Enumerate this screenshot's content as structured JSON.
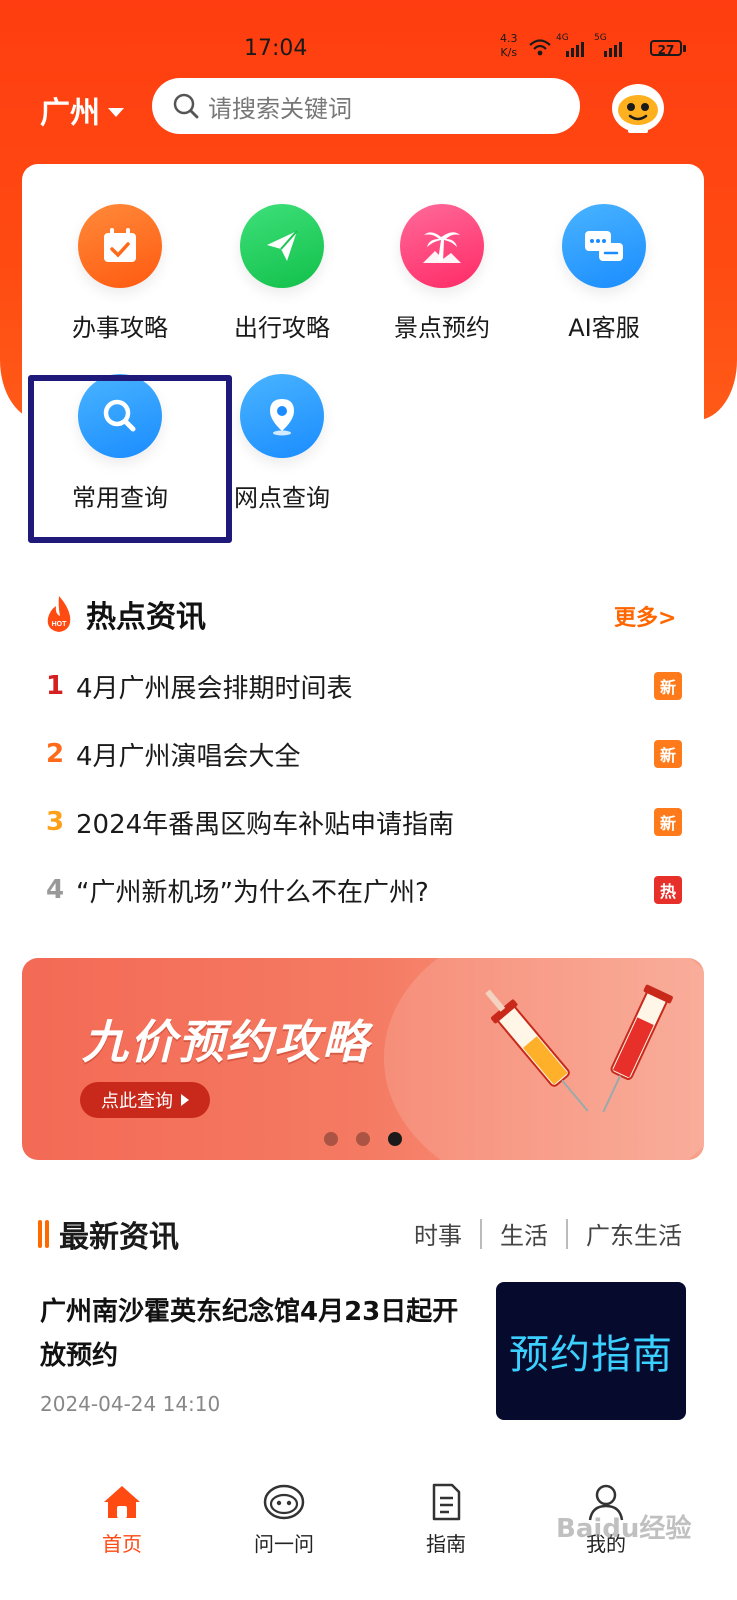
{
  "status_bar": {
    "time": "17:04",
    "net_speed_value": "4.3",
    "net_speed_unit": "K/s",
    "network_1": "4G",
    "network_2": "5G",
    "battery": "27"
  },
  "header": {
    "city": "广州",
    "search_placeholder": "请搜索关键词",
    "assistant_icon": "robot-face-icon"
  },
  "services": [
    {
      "label": "办事攻略",
      "icon": "calendar-check-icon",
      "color": "#ff6a1a"
    },
    {
      "label": "出行攻略",
      "icon": "paper-plane-icon",
      "color": "#1ccf5a"
    },
    {
      "label": "景点预约",
      "icon": "palm-tree-icon",
      "color": "#ff3f7a"
    },
    {
      "label": "AI客服",
      "icon": "chat-bubbles-icon",
      "color": "#2a9cff"
    },
    {
      "label": "常用查询",
      "icon": "search-icon",
      "color": "#2a9cff"
    },
    {
      "label": "网点查询",
      "icon": "location-pin-icon",
      "color": "#2a9cff"
    }
  ],
  "hot_news": {
    "title": "热点资讯",
    "fire_badge": "HOT",
    "more": "更多>",
    "items": [
      {
        "num": "1",
        "text": "4月广州展会排期时间表",
        "badge": "新",
        "num_color": "#d42020",
        "badge_color": "#ff7a1a"
      },
      {
        "num": "2",
        "text": "4月广州演唱会大全",
        "badge": "新",
        "num_color": "#ff6a1a",
        "badge_color": "#ff7a1a"
      },
      {
        "num": "3",
        "text": "2024年番禺区购车补贴申请指南",
        "badge": "新",
        "num_color": "#ffa01a",
        "badge_color": "#ff7a1a"
      },
      {
        "num": "4",
        "text": "“广州新机场”为什么不在广州?",
        "badge": "热",
        "num_color": "#999999",
        "badge_color": "#e8302a"
      }
    ]
  },
  "banner": {
    "headline": "九价预约攻略",
    "button": "点此查询",
    "active_slide": 3,
    "slides": 3
  },
  "latest_news": {
    "title": "最新资讯",
    "tabs": [
      "时事",
      "生活",
      "广东生活"
    ],
    "article": {
      "title": "广州南沙霍英东纪念馆4月23日起开放预约",
      "date": "2024-04-24 14:10",
      "thumb_text": "预约指南"
    }
  },
  "bottom_nav": [
    {
      "label": "首页",
      "icon": "home-icon",
      "active": true
    },
    {
      "label": "问一问",
      "icon": "robot-icon",
      "active": false
    },
    {
      "label": "指南",
      "icon": "document-icon",
      "active": false
    },
    {
      "label": "我的",
      "icon": "user-icon",
      "active": false
    }
  ],
  "watermark": "Baidu经验"
}
